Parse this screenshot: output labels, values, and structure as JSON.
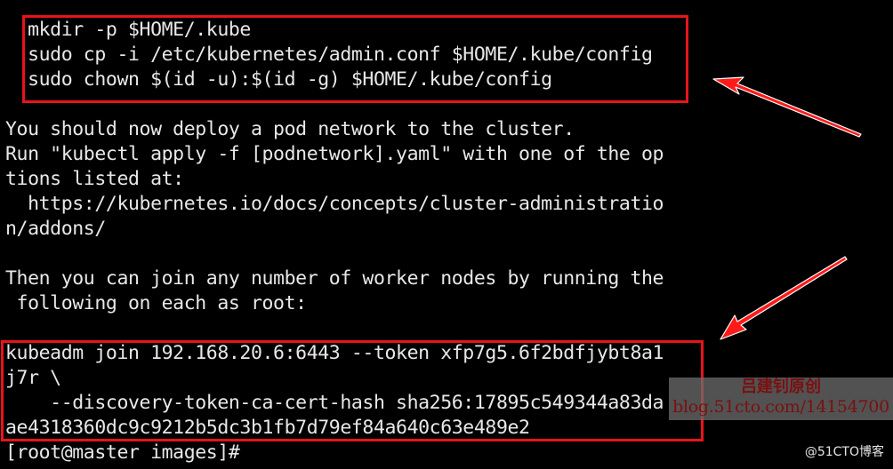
{
  "terminal": {
    "lines": [
      "  mkdir -p $HOME/.kube",
      "  sudo cp -i /etc/kubernetes/admin.conf $HOME/.kube/config",
      "  sudo chown $(id -u):$(id -g) $HOME/.kube/config",
      "",
      "You should now deploy a pod network to the cluster.",
      "Run \"kubectl apply -f [podnetwork].yaml\" with one of the op",
      "tions listed at:",
      "  https://kubernetes.io/docs/concepts/cluster-administratio",
      "n/addons/",
      "",
      "Then you can join any number of worker nodes by running the",
      " following on each as root:",
      "",
      "kubeadm join 192.168.20.6:6443 --token xfp7g5.6f2bdfjybt8a1",
      "j7r \\",
      "    --discovery-token-ca-cert-hash sha256:17895c549344a83da",
      "ae4318360dc9c9212b5dc3b1fb7d79ef84a640c63e489e2",
      "[root@master images]#"
    ],
    "prompt": "[root@master images]#"
  },
  "annotations": {
    "highlight_color": "#e8141b",
    "highlight_boxes": [
      "kube-config-commands",
      "kubeadm-join-command"
    ],
    "arrows": [
      "arrow-to-config-commands",
      "arrow-to-join-command"
    ]
  },
  "watermark": {
    "line1": "吕建钊原创",
    "line2": "blog.51cto.com/14154700"
  },
  "credit": "@51CTO博客"
}
